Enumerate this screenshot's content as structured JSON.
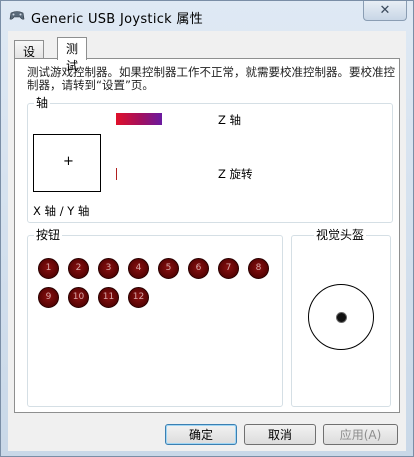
{
  "window": {
    "title": "Generic  USB  Joystick  属性",
    "close_glyph": "✕"
  },
  "tabs": [
    {
      "label": "设置",
      "active": false
    },
    {
      "label": "测试",
      "active": true
    }
  ],
  "description": "测试游戏控制器。如果控制器工作不正常，就需要校准控制器。要校准控制器，请转到“设置”页。",
  "axes": {
    "group_label": "轴",
    "xy_marker": "+",
    "xy_label": "X 轴 / Y 轴",
    "z_label": "Z 轴",
    "rz_label": "Z 旋转",
    "z_fill_colors": [
      "#e0102a",
      "#6a1aa0"
    ]
  },
  "buttons_group": {
    "label": "按钮",
    "buttons": [
      "1",
      "2",
      "3",
      "4",
      "5",
      "6",
      "7",
      "8",
      "9",
      "10",
      "11",
      "12"
    ],
    "pressed_color": "#6a0606"
  },
  "pov": {
    "label": "视觉头盔"
  },
  "actions": {
    "ok": "确定",
    "cancel": "取消",
    "apply": "应用(A)"
  }
}
